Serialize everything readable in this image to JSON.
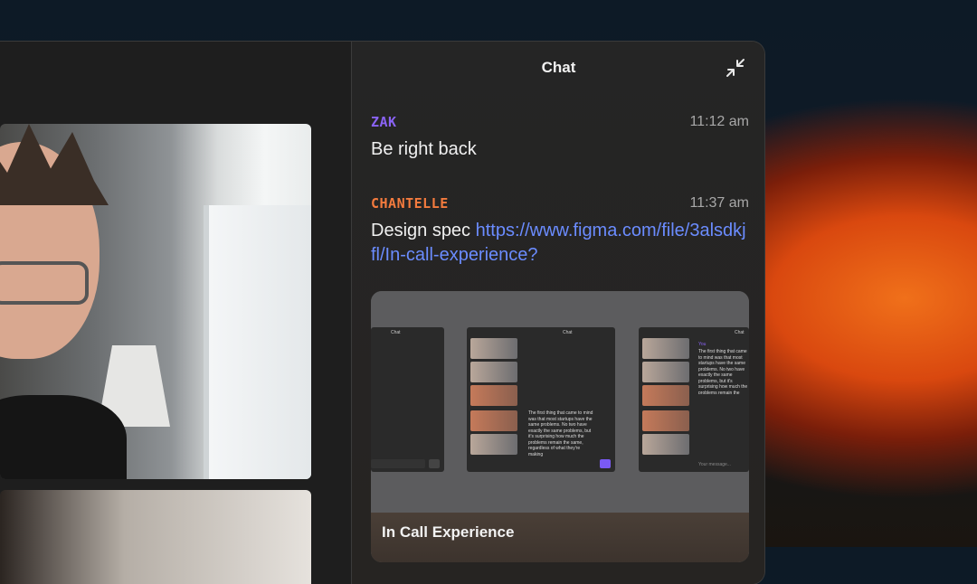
{
  "chat": {
    "title": "Chat",
    "messages": [
      {
        "author": "ZAK",
        "time": "11:12 am",
        "text": "Be right back"
      },
      {
        "author": "CHANTELLE",
        "time": "11:37 am",
        "text_prefix": "Design spec ",
        "link": "https://www.figma.com/file/3alsdkjfl/In-call-experience?"
      }
    ],
    "preview": {
      "caption": "In Call Experience",
      "mini_chat_label": "Chat",
      "mini_placeholder": "Your message...",
      "mini_message": "The first thing that came to mind was that most startups have the same problems. No two have exactly the same problems, but it's surprising how much the problems remain the same, regardless of what they're making",
      "mini_you": "You"
    }
  },
  "colors": {
    "zak": "#8a63f5",
    "chantelle": "#f47b3e",
    "link": "#6b8cff"
  },
  "icons": [
    "collapse-icon"
  ]
}
